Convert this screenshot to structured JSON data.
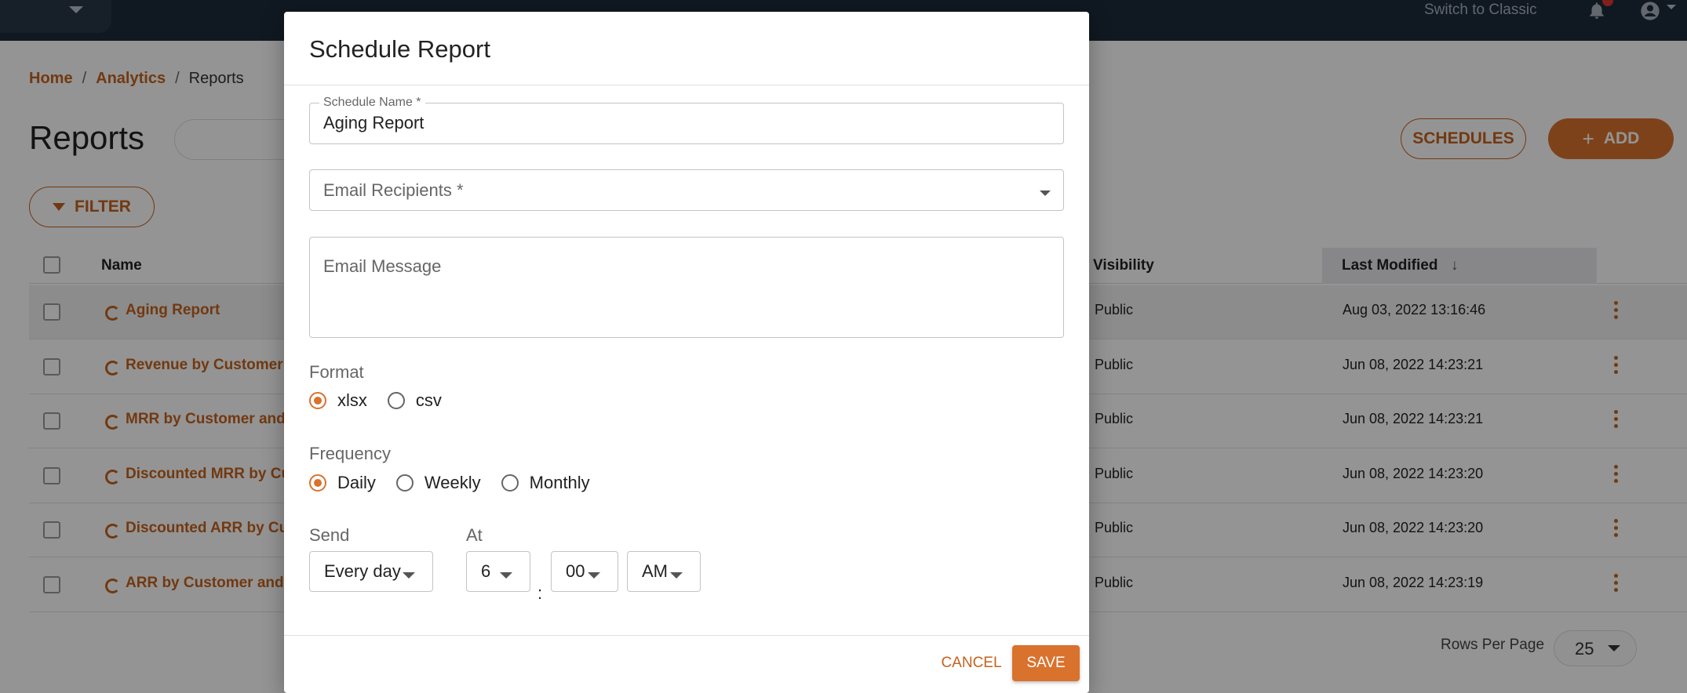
{
  "topbar": {
    "switch_classic": "Switch to Classic"
  },
  "breadcrumb": {
    "home": "Home",
    "analytics": "Analytics",
    "current": "Reports",
    "separator": "/"
  },
  "page": {
    "title": "Reports",
    "schedules_label": "SCHEDULES",
    "add_label": "ADD",
    "add_icon": "+",
    "filter_label": "FILTER"
  },
  "table": {
    "headers": {
      "name": "Name",
      "visibility": "Visibility",
      "last_modified": "Last Modified",
      "sort_indicator": "↓"
    },
    "rows": [
      {
        "name": "Aging Report",
        "visibility": "Public",
        "modified": "Aug 03, 2022 13:16:46"
      },
      {
        "name": "Revenue by Customer",
        "visibility": "Public",
        "modified": "Jun 08, 2022 14:23:21"
      },
      {
        "name": "MRR by Customer and",
        "visibility": "Public",
        "modified": "Jun 08, 2022 14:23:21"
      },
      {
        "name": "Discounted MRR by Cu",
        "visibility": "Public",
        "modified": "Jun 08, 2022 14:23:20"
      },
      {
        "name": "Discounted ARR by Cu",
        "visibility": "Public",
        "modified": "Jun 08, 2022 14:23:20"
      },
      {
        "name": "ARR by Customer and",
        "visibility": "Public",
        "modified": "Jun 08, 2022 14:23:19"
      }
    ]
  },
  "pagination": {
    "rows_per_page_label": "Rows Per Page",
    "rows_per_page_value": "25"
  },
  "dialog": {
    "title": "Schedule Report",
    "schedule_name_label": "Schedule Name *",
    "schedule_name_value": "Aging Report",
    "email_recipients_placeholder": "Email Recipients *",
    "email_message_placeholder": "Email Message",
    "format_label": "Format",
    "format_options": [
      {
        "label": "xlsx",
        "selected": true
      },
      {
        "label": "csv",
        "selected": false
      }
    ],
    "frequency_label": "Frequency",
    "frequency_options": [
      {
        "label": "Daily",
        "selected": true
      },
      {
        "label": "Weekly",
        "selected": false
      },
      {
        "label": "Monthly",
        "selected": false
      }
    ],
    "send_label": "Send",
    "send_value": "Every day",
    "at_label": "At",
    "hour_value": "6",
    "minute_value": "00",
    "ampm_value": "AM",
    "time_separator": ":",
    "cancel_label": "CANCEL",
    "save_label": "SAVE"
  },
  "colors": {
    "accent": "#d9722d",
    "link": "#c4621e",
    "topbar": "#1c2a3a"
  }
}
